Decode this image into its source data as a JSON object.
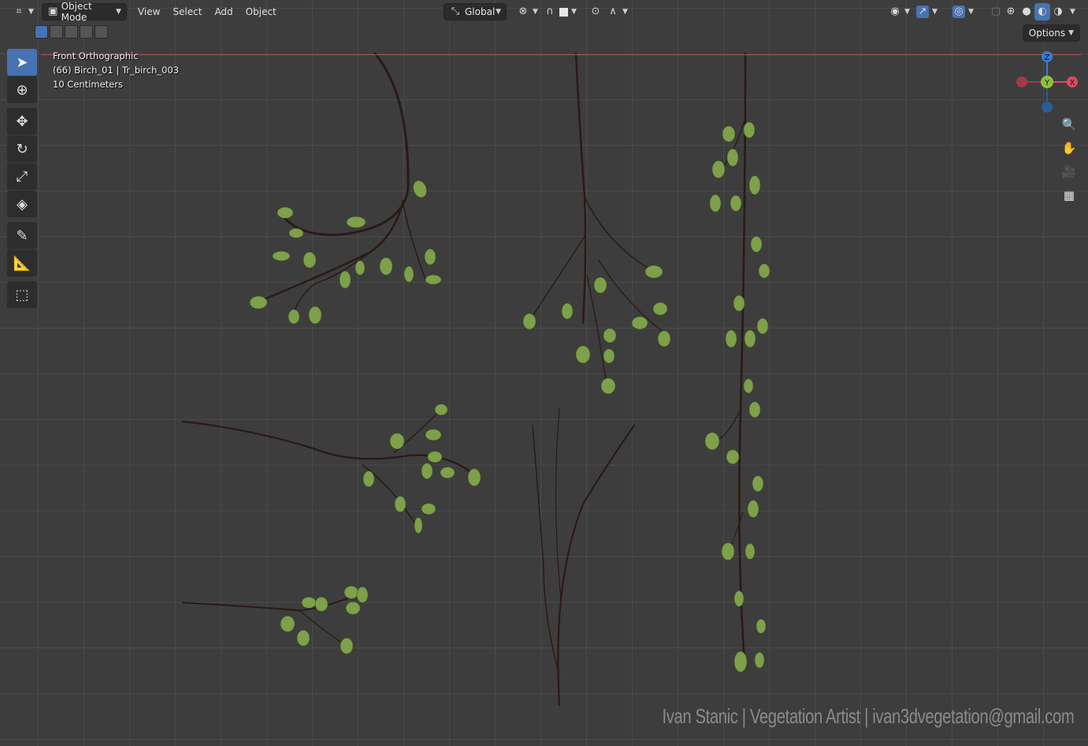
{
  "header": {
    "editor_icon": "editor-type-icon",
    "mode_label": "Object Mode",
    "menus": [
      "View",
      "Select",
      "Add",
      "Object"
    ],
    "transform_orientation": "Global",
    "options_label": "Options"
  },
  "select_modes": [
    "set-new",
    "extend",
    "subtract",
    "difference",
    "intersect"
  ],
  "tools": [
    {
      "name": "select-box",
      "icon": "cursor-icon"
    },
    {
      "name": "cursor",
      "icon": "crosshair-icon"
    },
    {
      "name": "move",
      "icon": "move-icon"
    },
    {
      "name": "rotate",
      "icon": "rotate-icon"
    },
    {
      "name": "scale",
      "icon": "scale-icon"
    },
    {
      "name": "transform",
      "icon": "transform-icon"
    },
    {
      "name": "annotate",
      "icon": "pencil-icon"
    },
    {
      "name": "measure",
      "icon": "ruler-icon"
    },
    {
      "name": "add-cube",
      "icon": "add-cube-icon"
    }
  ],
  "viewport": {
    "view_name": "Front Orthographic",
    "object_info": "(66) Birch_01 | Tr_birch_003",
    "grid_scale": "10 Centimeters"
  },
  "gizmo": {
    "z": "Z",
    "y": "Y",
    "x": "X"
  },
  "watermark": "Ivan Stanic | Vegetation Artist | ivan3dvegetation@gmail.com",
  "colors": {
    "accent": "#4772b3",
    "axis_x": "#e04a5f",
    "axis_y": "#8bc33f",
    "axis_z": "#3f7ad0",
    "branch": "#2a1a16",
    "leaf": "#7ea04a"
  }
}
